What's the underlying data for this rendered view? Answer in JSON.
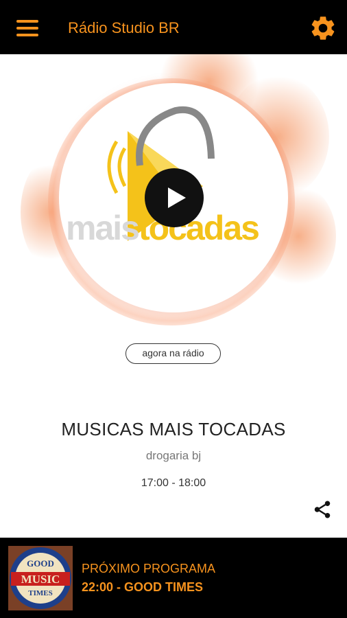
{
  "header": {
    "title": "Rádio Studio BR",
    "menu_icon": "hamburger-menu-icon",
    "settings_icon": "gear-icon"
  },
  "hero": {
    "logo_text_part1": "mais",
    "logo_text_part2": "tocadas",
    "play_icon": "play-icon"
  },
  "now_playing": {
    "badge": "agora na rádio",
    "program": "MUSICAS MAIS TOCADAS",
    "host": "drogaria bj",
    "time": "17:00 - 18:00",
    "share_icon": "share-icon"
  },
  "next": {
    "label": "PRÓXIMO PROGRAMA",
    "value": "22:00 - GOOD TIMES",
    "thumb_lines": [
      "GOOD",
      "MUSIC",
      "TIMES"
    ]
  },
  "colors": {
    "accent": "#f7931e",
    "bar": "#000000",
    "logo_yellow": "#f4c21a"
  }
}
